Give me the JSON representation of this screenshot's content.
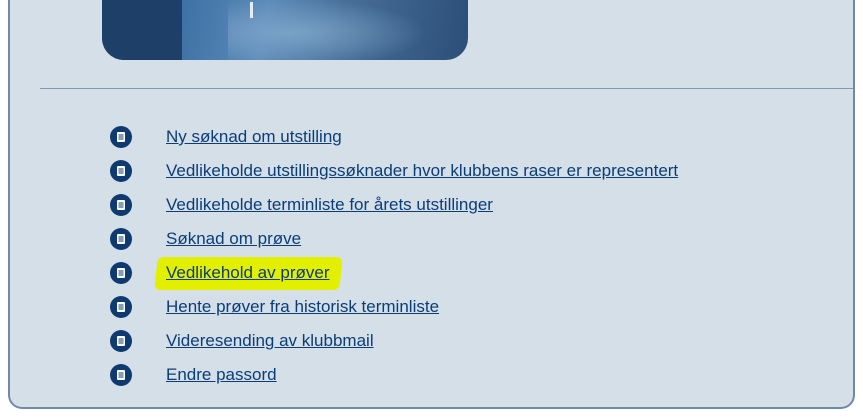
{
  "menu": {
    "items": [
      {
        "label": "Ny søknad om utstilling",
        "highlighted": false
      },
      {
        "label": "Vedlikeholde utstillingssøknader hvor klubbens raser er representert",
        "highlighted": false
      },
      {
        "label": "Vedlikeholde terminliste for årets utstillinger",
        "highlighted": false
      },
      {
        "label": "Søknad om prøve",
        "highlighted": false
      },
      {
        "label": "Vedlikehold av prøver",
        "highlighted": true
      },
      {
        "label": "Hente prøver fra historisk terminliste",
        "highlighted": false
      },
      {
        "label": "Videresending av klubbmail",
        "highlighted": false
      },
      {
        "label": "Endre passord",
        "highlighted": false
      }
    ],
    "icon": "document-icon"
  },
  "colors": {
    "panel_background": "#d4dfe8",
    "link": "#0b3d78",
    "icon_fill": "#0f3a6f",
    "highlight": "#e2f000"
  }
}
